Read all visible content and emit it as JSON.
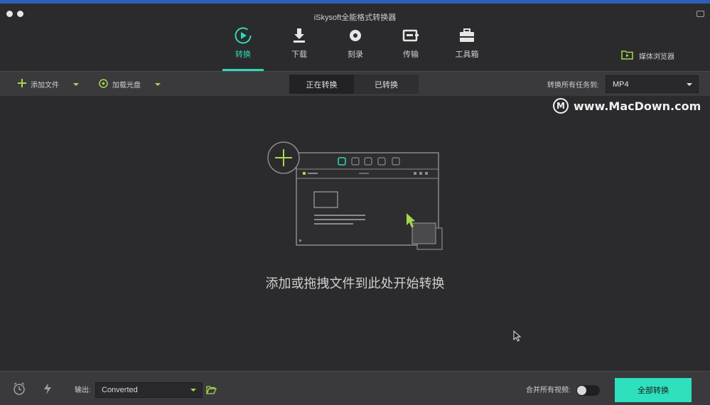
{
  "window": {
    "title": "iSkysoft全能格式转换器"
  },
  "nav": {
    "items": [
      {
        "label": "转换",
        "icon": "convert-icon",
        "active": true
      },
      {
        "label": "下载",
        "icon": "download-icon",
        "active": false
      },
      {
        "label": "刻录",
        "icon": "burn-disc-icon",
        "active": false
      },
      {
        "label": "传输",
        "icon": "transfer-icon",
        "active": false
      },
      {
        "label": "工具箱",
        "icon": "toolbox-icon",
        "active": false
      }
    ],
    "media_browser": "媒体浏览器"
  },
  "toolbar": {
    "add_files": "添加文件",
    "load_disc": "加载光盘",
    "tabs": [
      {
        "label": "正在转换",
        "selected": true
      },
      {
        "label": "已转换",
        "selected": false
      }
    ],
    "convert_all_to_label": "转换所有任务到:",
    "format_value": "MP4"
  },
  "main": {
    "drop_hint": "添加或拖拽文件到此处开始转换"
  },
  "watermark": {
    "text": "www.MacDown.com",
    "letter": "M"
  },
  "bottom": {
    "output_label": "输出:",
    "output_value": "Converted",
    "merge_label": "合并所有视频:",
    "merge_on": false,
    "convert_all_button": "全部转换"
  },
  "colors": {
    "accent_teal": "#2fd9b7",
    "accent_green": "#a6d84b",
    "button_teal": "#2ee0bd",
    "background": "#2b2b2d",
    "toolbar": "#3a3a3d"
  }
}
